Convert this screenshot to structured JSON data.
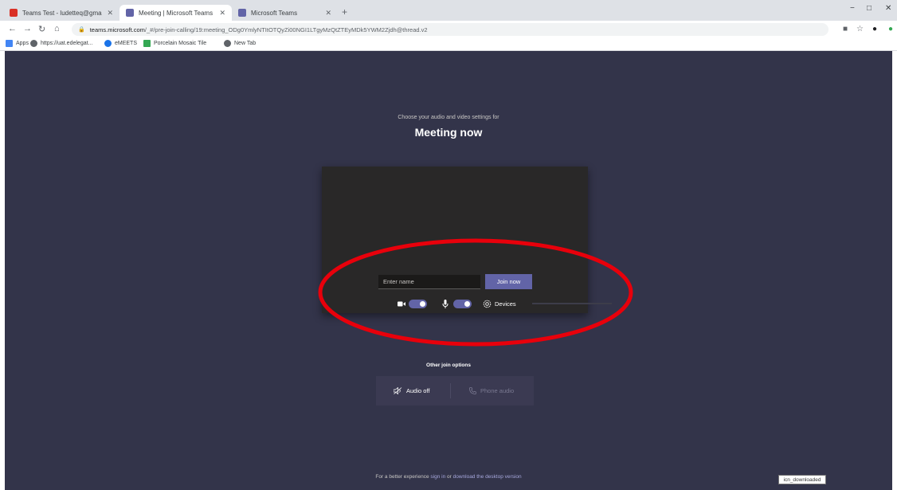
{
  "browser": {
    "tabs": [
      {
        "title": "Teams Test - ludetteq@gmail.co",
        "favicon": "gmail-icon",
        "color": "#d93025"
      },
      {
        "title": "Meeting | Microsoft Teams",
        "favicon": "teams-icon",
        "color": "#6264a7"
      },
      {
        "title": "Microsoft Teams",
        "favicon": "teams-icon",
        "color": "#6264a7"
      }
    ],
    "new_tab_glyph": "+",
    "window_controls": [
      "−",
      "□",
      "✕"
    ],
    "url_host": "teams.microsoft.com",
    "url_path": "/_#/pre-join-calling/19:meeting_ODg0YmlyNTItOTQyZi00NGI1LTgyMzQtZTEyMDk5YWM2Zjdh@thread.v2",
    "bookmarks": [
      {
        "label": "Apps",
        "icon": "apps-grid-icon"
      },
      {
        "label": "https://uat.edelegat...",
        "icon": "globe-icon"
      },
      {
        "label": "eMEETS",
        "icon": "emeets-icon"
      },
      {
        "label": "Porcelain Mosaic Tile",
        "icon": "m-logo-icon"
      },
      {
        "label": "New Tab",
        "icon": "globe-icon"
      }
    ]
  },
  "prejoin": {
    "subtitle": "Choose your audio and video settings for",
    "title": "Meeting now",
    "name_placeholder": "Enter name",
    "join_label": "Join now",
    "camera_on": true,
    "mic_on": true,
    "devices_label": "Devices"
  },
  "other_options": {
    "heading": "Other join options",
    "audio_off_label": "Audio off",
    "phone_audio_label": "Phone audio"
  },
  "footer": {
    "prefix": "For a better experience ",
    "sign_in": "sign in",
    "middle": " or ",
    "download": "download the desktop version"
  },
  "tooltip": "icn_downloaded",
  "colors": {
    "teams_bg": "#33344a",
    "accent": "#6264a7",
    "annotation": "#e8000b"
  }
}
